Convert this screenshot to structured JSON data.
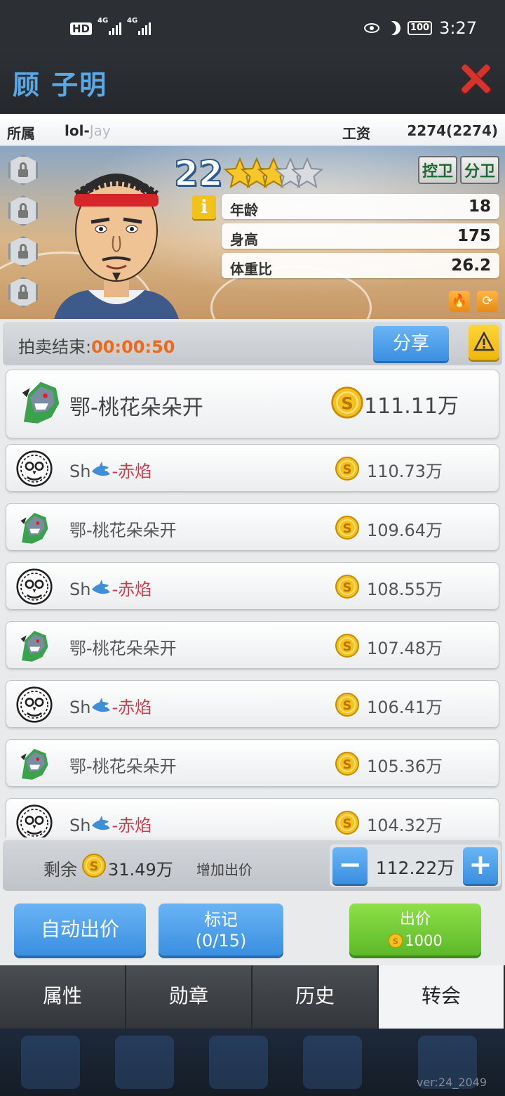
{
  "status_bar": {
    "hd": "HD",
    "sim1": "4G",
    "sim2": "4G",
    "battery": "100",
    "time": "3:27"
  },
  "header": {
    "player_name": "顾 子明"
  },
  "info": {
    "team_label": "所属",
    "team_prefix": "lol-",
    "team_suffix": "Jay",
    "salary_label": "工资",
    "salary_value": "2274(2274)"
  },
  "player": {
    "age_badge": "22",
    "stars_filled": 3,
    "stars_total": 5,
    "positions": [
      "控卫",
      "分卫"
    ],
    "info_icon": "i",
    "stats": [
      {
        "label": "年龄",
        "value": "18"
      },
      {
        "label": "身高",
        "value": "175"
      },
      {
        "label": "体重比",
        "value": "26.2"
      }
    ]
  },
  "auction": {
    "label": "拍卖结束:",
    "time": "00:00:50",
    "share_label": "分享"
  },
  "bids": [
    {
      "team_a": "鄂-桃花朵朵开",
      "team_b": "",
      "amount": "111.11万",
      "logo": "dino-logo"
    },
    {
      "team_a": "Sh",
      "team_b": "-赤焰",
      "amount": "110.73万",
      "logo": "owl-logo"
    },
    {
      "team_a": "鄂-桃花朵朵开",
      "team_b": "",
      "amount": "109.64万",
      "logo": "dino-logo"
    },
    {
      "team_a": "Sh",
      "team_b": "-赤焰",
      "amount": "108.55万",
      "logo": "owl-logo"
    },
    {
      "team_a": "鄂-桃花朵朵开",
      "team_b": "",
      "amount": "107.48万",
      "logo": "dino-logo"
    },
    {
      "team_a": "Sh",
      "team_b": "-赤焰",
      "amount": "106.41万",
      "logo": "owl-logo"
    },
    {
      "team_a": "鄂-桃花朵朵开",
      "team_b": "",
      "amount": "105.36万",
      "logo": "dino-logo"
    },
    {
      "team_a": "Sh",
      "team_b": "-赤焰",
      "amount": "104.32万",
      "logo": "owl-logo"
    }
  ],
  "bid_control": {
    "remain_label": "剩余",
    "remain_value": "31.49万",
    "increase_label": "增加出价",
    "bid_value": "112.22万",
    "minus": "−",
    "plus": "+"
  },
  "actions": {
    "auto_bid": "自动出价",
    "mark_label": "标记",
    "mark_count": "(0/15)",
    "bid_label": "出价",
    "bid_cost": "1000"
  },
  "tabs": [
    "属性",
    "勋章",
    "历史",
    "转会"
  ],
  "active_tab": 3,
  "version": "ver:24_2049",
  "colors": {
    "accent_blue": "#3a8fe0",
    "bid_green": "#5cb82a",
    "timer_orange": "#ee6a1a",
    "close_red": "#d6332c"
  }
}
